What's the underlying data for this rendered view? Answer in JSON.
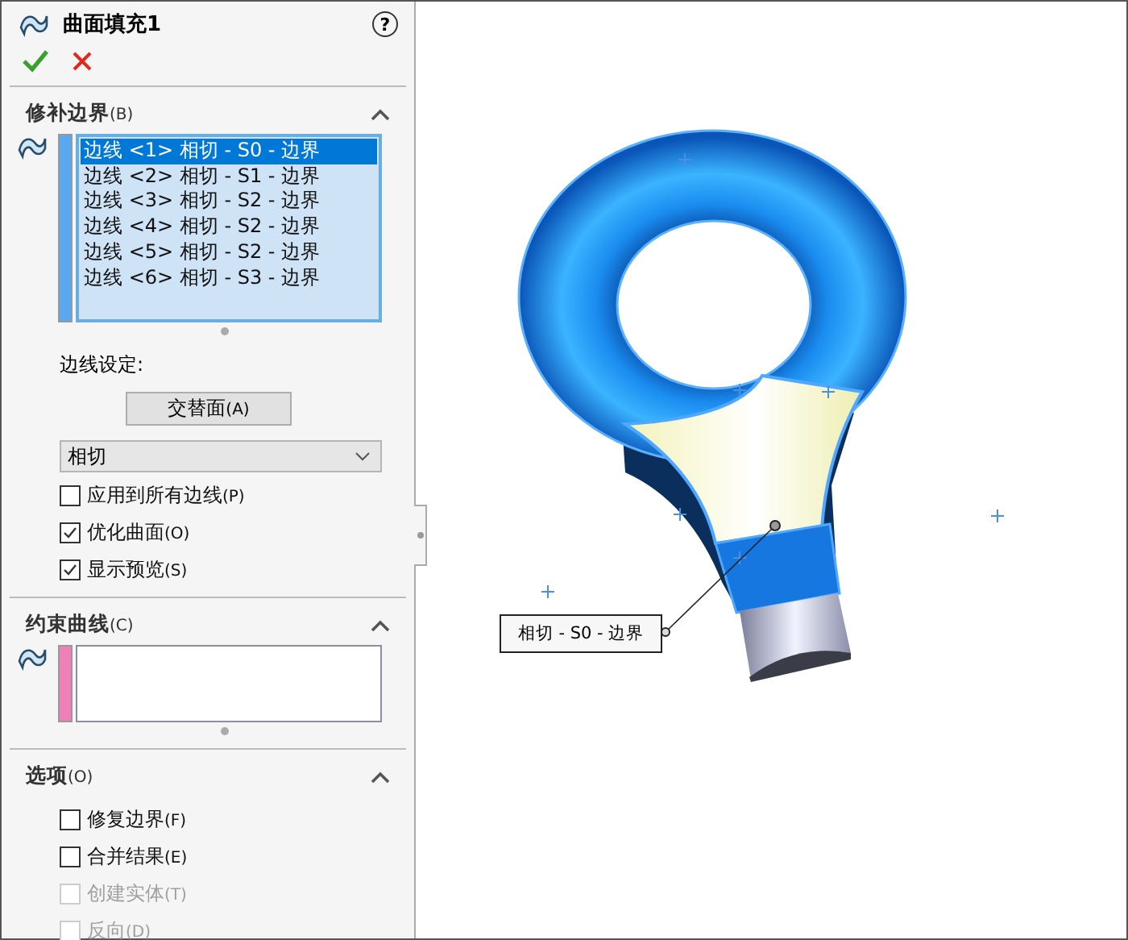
{
  "panel": {
    "title": "曲面填充1",
    "help": "?"
  },
  "patch_boundary": {
    "title": "修补边界",
    "shortcut": "(B)",
    "expanded": true,
    "edges": [
      {
        "label": "边线 <1> 相切 - S0 - 边界",
        "selected": true
      },
      {
        "label": "边线 <2> 相切 - S1 - 边界",
        "selected": false
      },
      {
        "label": "边线 <3> 相切 - S2 - 边界",
        "selected": false
      },
      {
        "label": "边线 <4> 相切 - S2 - 边界",
        "selected": false
      },
      {
        "label": "边线 <5> 相切 - S2 - 边界",
        "selected": false
      },
      {
        "label": "边线 <6> 相切 - S3 - 边界",
        "selected": false
      }
    ],
    "settings_label": "边线设定:",
    "alternate_button": {
      "label": "交替面",
      "shortcut": "(A)"
    },
    "condition": {
      "value": "相切"
    },
    "checkboxes": [
      {
        "label": "应用到所有边线",
        "shortcut": "(P)",
        "checked": false,
        "disabled": false
      },
      {
        "label": "优化曲面",
        "shortcut": "(O)",
        "checked": true,
        "disabled": false
      },
      {
        "label": "显示预览",
        "shortcut": "(S)",
        "checked": true,
        "disabled": false
      }
    ]
  },
  "constraint_curves": {
    "title": "约束曲线",
    "shortcut": "(C)",
    "expanded": true
  },
  "options": {
    "title": "选项",
    "shortcut": "(O)",
    "expanded": true,
    "checkboxes": [
      {
        "label": "修复边界",
        "shortcut": "(F)",
        "checked": false,
        "disabled": false
      },
      {
        "label": "合并结果",
        "shortcut": "(E)",
        "checked": false,
        "disabled": false
      },
      {
        "label": "创建实体",
        "shortcut": "(T)",
        "checked": false,
        "disabled": true
      },
      {
        "label": "反向",
        "shortcut": "(D)",
        "checked": false,
        "disabled": true
      }
    ]
  },
  "viewport": {
    "callout": "相切 - S0 - 边界"
  }
}
